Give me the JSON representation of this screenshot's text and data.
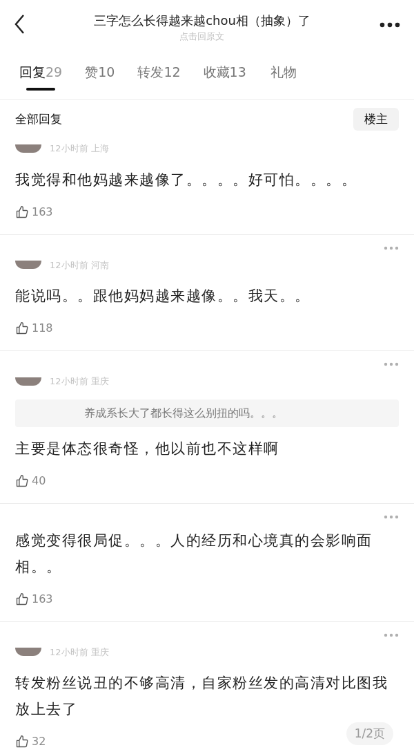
{
  "header": {
    "title": "三字怎么长得越来越chou相（抽象）了",
    "subtitle": "点击回原文"
  },
  "tabs": [
    {
      "label": "回复",
      "count": "29",
      "selected": true
    },
    {
      "label": "赞",
      "count": "10",
      "selected": false
    },
    {
      "label": "转发",
      "count": "12",
      "selected": false
    },
    {
      "label": "收藏",
      "count": "13",
      "selected": false
    },
    {
      "label": "礼物",
      "selected": false
    }
  ],
  "filter": {
    "label": "全部回复",
    "button": "楼主"
  },
  "comments": [
    {
      "meta": "12小时前 上海",
      "more": false,
      "text": "我觉得和他妈越来越像了。。。。好可怕。。。。",
      "likes": "163"
    },
    {
      "meta": "12小时前 河南",
      "more": true,
      "text": "能说吗。。跟他妈妈越来越像。。我天。。",
      "likes": "118"
    },
    {
      "meta": "12小时前 重庆",
      "more": true,
      "quote": "养成系长大了都长得这么别扭的吗。。。",
      "text": "主要是体态很奇怪，他以前也不这样啊",
      "likes": "40"
    },
    {
      "more": true,
      "text": "感觉变得很局促。。。人的经历和心境真的会影响面相。。",
      "likes": "163"
    },
    {
      "meta": "12小时前 重庆",
      "more": true,
      "text": "转发粉丝说丑的不够高清，自家粉丝发的高清对比图我放上去了",
      "likes": "32"
    }
  ],
  "page_indicator": "1/2页"
}
